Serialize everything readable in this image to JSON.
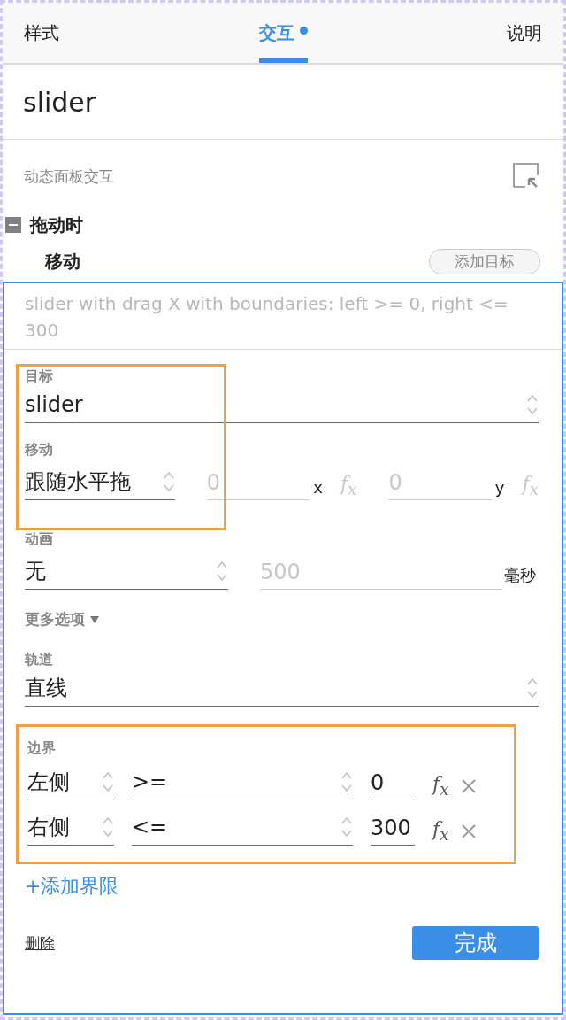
{
  "tabs": [
    {
      "label": "样式",
      "selected": false,
      "modified": false
    },
    {
      "label": "交互",
      "selected": true,
      "modified": true
    },
    {
      "label": "说明",
      "selected": false,
      "modified": false
    }
  ],
  "widget_name": "slider",
  "section_title": "动态面板交互",
  "event": {
    "label": "拖动时",
    "expanded": true
  },
  "action": {
    "label": "移动",
    "add_target_button": "添加目标"
  },
  "description": "slider with drag X  with boundaries: left >= 0, right <= 300",
  "target": {
    "label": "目标",
    "value": "slider",
    "highlighted": true
  },
  "move": {
    "label": "移动",
    "mode": "跟随水平拖",
    "x": {
      "value": "0",
      "unit": "x",
      "fx": "f$_{x}$",
      "disabled": true
    },
    "y": {
      "value": "0",
      "unit": "y",
      "fx": "f$_{x}$",
      "disabled": true
    }
  },
  "animation": {
    "label": "动画",
    "easing": "无",
    "duration": "500",
    "unit": "毫秒",
    "duration_disabled": true
  },
  "more_options": "更多选项",
  "track": {
    "label": "轨道",
    "value": "直线"
  },
  "boundaries": {
    "label": "边界",
    "highlighted": true,
    "rows": [
      {
        "side": "左侧",
        "operator": ">=",
        "value": "0",
        "fx": "f$_{x}$"
      },
      {
        "side": "右侧",
        "operator": "<=",
        "value": "300",
        "fx": "f$_{x}$"
      }
    ],
    "add_link": "+添加界限"
  },
  "delete_link": "删除",
  "done_button": "完成"
}
